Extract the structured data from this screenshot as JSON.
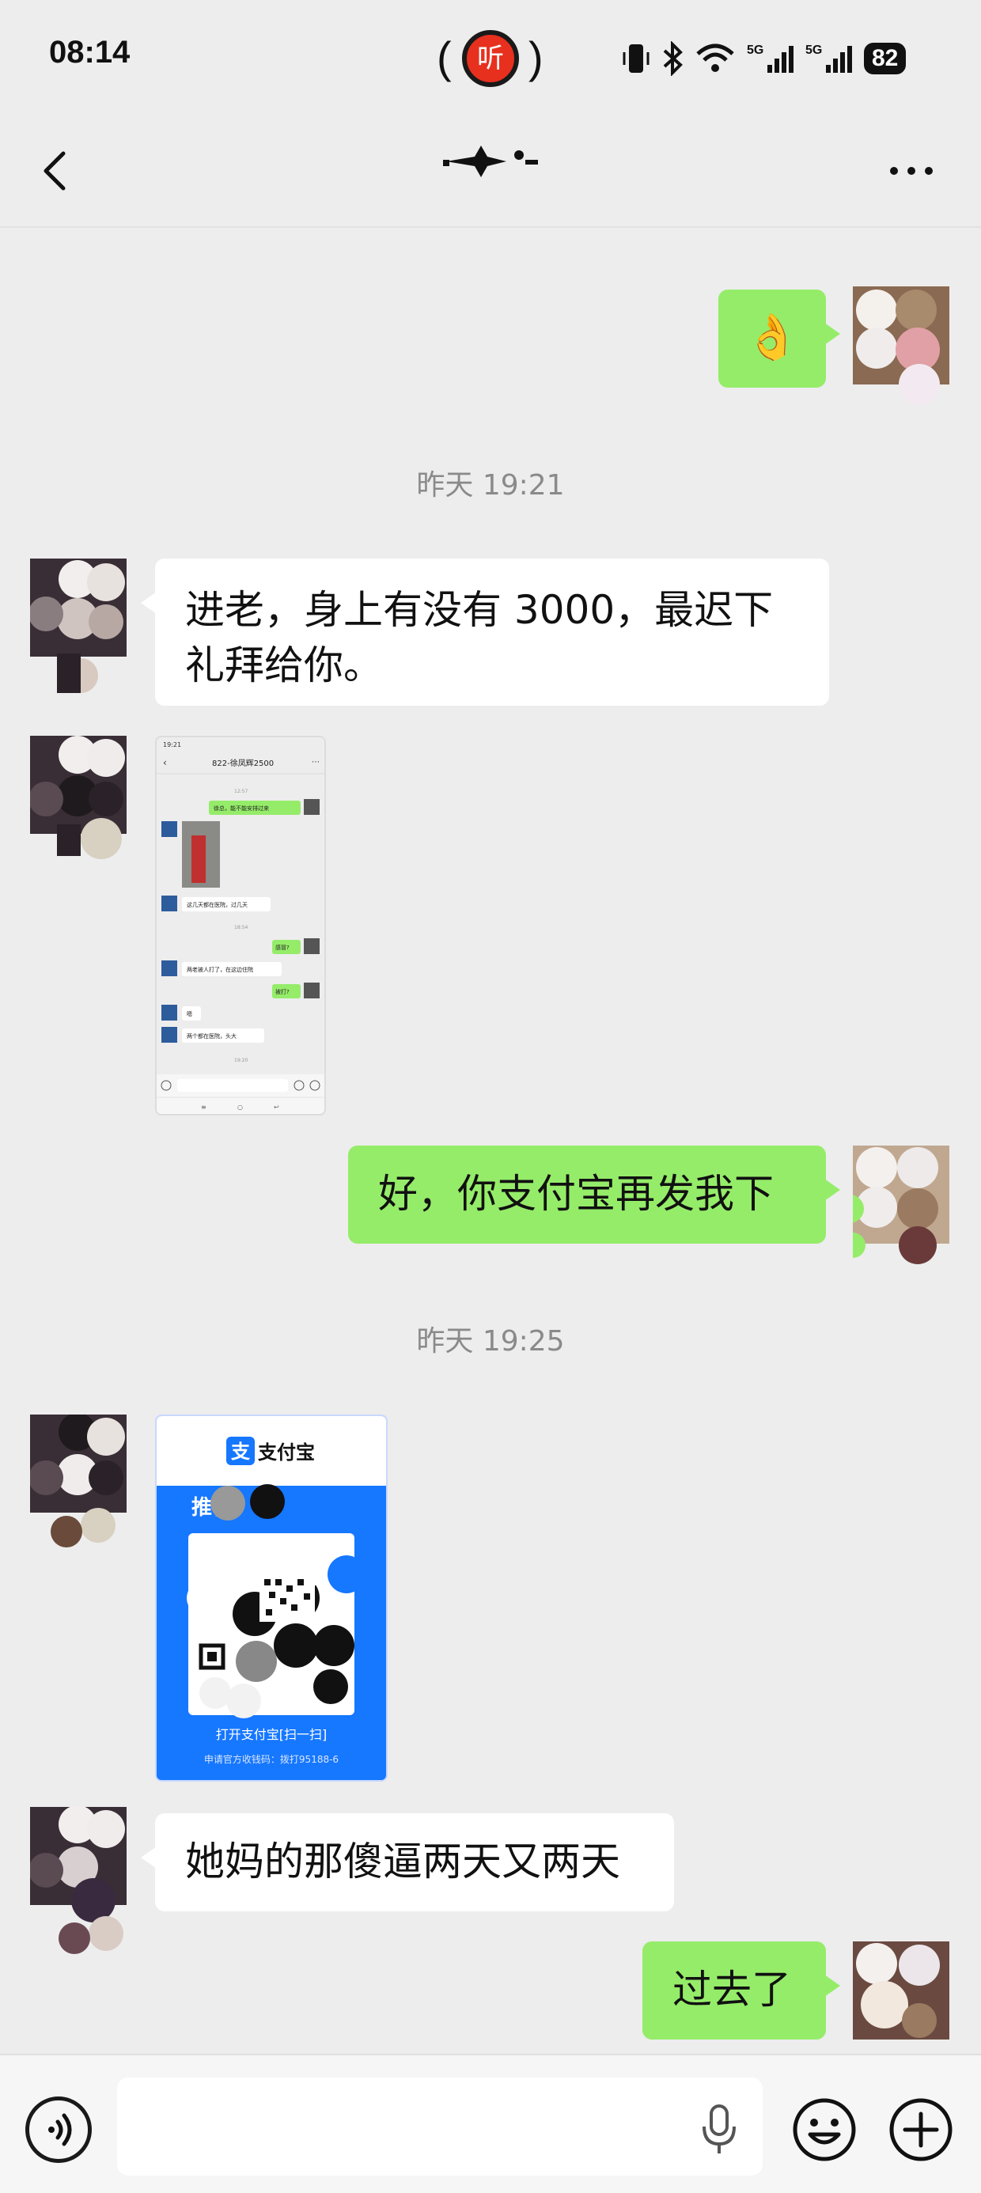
{
  "status_bar": {
    "time": "08:14",
    "listen_badge_char": "听",
    "paren_left": "(",
    "paren_right": ")",
    "battery_level": "82",
    "network_labels": [
      "5G",
      "5G"
    ]
  },
  "nav": {
    "back_icon": "chevron-left-icon",
    "more_icon": "more-dots-icon"
  },
  "messages": [
    {
      "side": "me",
      "type": "emoji",
      "content": "👌"
    },
    {
      "type": "timestamp",
      "text": "昨天 19:21"
    },
    {
      "side": "other",
      "type": "text",
      "lines": [
        "进老，身上有没有 3000，最迟下",
        "礼拜给你。"
      ]
    },
    {
      "side": "other",
      "type": "image",
      "description_icon": "chat-screenshot-image",
      "inner": {
        "status_time": "19:21",
        "title": "822-徐凤辉2500",
        "time1": "12:57",
        "msg1": "徐总，能不能安排过来",
        "msg2": "这几天都在医院，过几天",
        "time2": "18:54",
        "msg3": "感冒?",
        "msg4": "两老被人打了，在这边住院",
        "msg5": "被打?",
        "msg6": "嗯",
        "msg7": "两个都在医院，头大",
        "time3": "19:20"
      }
    },
    {
      "side": "me",
      "type": "text",
      "lines": [
        "好，你支付宝再发我下"
      ]
    },
    {
      "type": "timestamp",
      "text": "昨天 19:25"
    },
    {
      "side": "other",
      "type": "alipay-qr",
      "brand": "支付宝",
      "brand_icon": "支",
      "banner_text": "推荐",
      "scan_text": "打开支付宝[扫一扫]",
      "footer_text": "申请官方收钱码：拨打95188-6"
    },
    {
      "side": "other",
      "type": "text",
      "lines": [
        "她妈的那傻逼两天又两天"
      ]
    },
    {
      "side": "me",
      "type": "text",
      "lines": [
        "过去了"
      ]
    }
  ],
  "bottom_bar": {
    "voice_icon": "voice-input-icon",
    "mic_icon": "microphone-icon",
    "emoji_icon": "emoji-icon",
    "plus_icon": "plus-icon"
  },
  "colors": {
    "background": "#ededed",
    "my_bubble": "#95ec69",
    "other_bubble": "#ffffff",
    "alipay_blue": "#1677ff",
    "listen_red": "#e8301f"
  }
}
